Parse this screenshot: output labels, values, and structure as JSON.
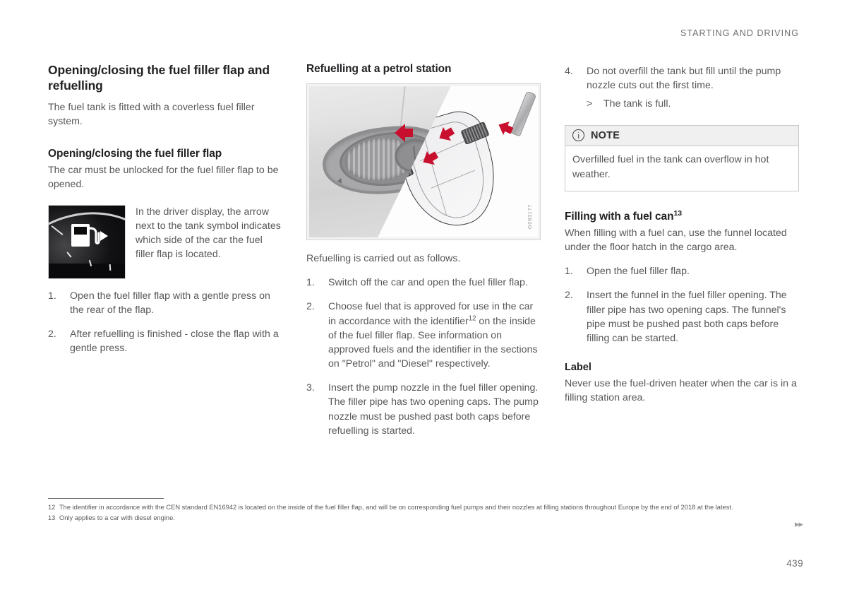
{
  "header": {
    "running_title": "STARTING AND DRIVING"
  },
  "column_left": {
    "section_title": "Opening/closing the fuel filler flap and refuelling",
    "intro": "The fuel tank is fitted with a coverless fuel filler system.",
    "sub_title": "Opening/closing the fuel filler flap",
    "sub_intro": "The car must be unlocked for the fuel filler flap to be opened.",
    "driver_display": {
      "image_name": "driver-display-fuel-symbol",
      "caption": "In the driver display, the arrow next to the tank symbol indicates which side of the car the fuel filler flap is located."
    },
    "steps": [
      {
        "num": "1.",
        "text": "Open the fuel filler flap with a gentle press on the rear of the flap."
      },
      {
        "num": "2.",
        "text": "After refuelling is finished - close the flap with a gentle press."
      }
    ]
  },
  "column_middle": {
    "section_title": "Refuelling at a petrol station",
    "illustration": {
      "image_name": "fuel-filler-flap-and-filler-pipe",
      "code": "G083177"
    },
    "lead": "Refuelling is carried out as follows.",
    "steps": [
      {
        "num": "1.",
        "text": "Switch off the car and open the fuel filler flap."
      },
      {
        "num": "2.",
        "text_before": "Choose fuel that is approved for use in the car in accordance with the identifier",
        "footnote": "12",
        "text_after": " on the inside of the fuel filler flap. See information on approved fuels and the identifier in the sections on \"Petrol\" and \"Diesel\" respectively."
      },
      {
        "num": "3.",
        "text": "Insert the pump nozzle in the fuel filler opening. The filler pipe has two opening caps. The pump nozzle must be pushed past both caps before refuelling is started."
      }
    ]
  },
  "column_right": {
    "step4": {
      "num": "4.",
      "text": "Do not overfill the tank but fill until the pump nozzle cuts out the first time.",
      "result_marker": ">",
      "result_text": "The tank is full."
    },
    "note": {
      "icon_name": "info-icon",
      "title": "NOTE",
      "body": "Overfilled fuel in the tank can overflow in hot weather."
    },
    "fuel_can": {
      "title_before": "Filling with a fuel can",
      "title_footnote": "13",
      "intro": "When filling with a fuel can, use the funnel located under the floor hatch in the cargo area.",
      "steps": [
        {
          "num": "1.",
          "text": "Open the fuel filler flap."
        },
        {
          "num": "2.",
          "text": "Insert the funnel in the fuel filler opening. The filler pipe has two opening caps. The funnel's pipe must be pushed past both caps before filling can be started."
        }
      ]
    },
    "label": {
      "title": "Label",
      "body": "Never use the fuel-driven heater when the car is in a filling station area."
    }
  },
  "footnotes": [
    {
      "num": "12",
      "text": "The identifier in accordance with the CEN standard EN16942 is located on the inside of the fuel filler flap, and will be on corresponding fuel pumps and their nozzles at filling stations throughout Europe by the end of 2018 at the latest."
    },
    {
      "num": "13",
      "text": "Only applies to a car with diesel engine."
    }
  ],
  "footer": {
    "arrows": "▸▸",
    "page_number": "439"
  },
  "colors": {
    "accent_red": "#c8102e",
    "text_body": "#58585a",
    "text_heading": "#222224",
    "note_header_bg": "#f0f0f0",
    "rule": "#c9c9cb"
  }
}
